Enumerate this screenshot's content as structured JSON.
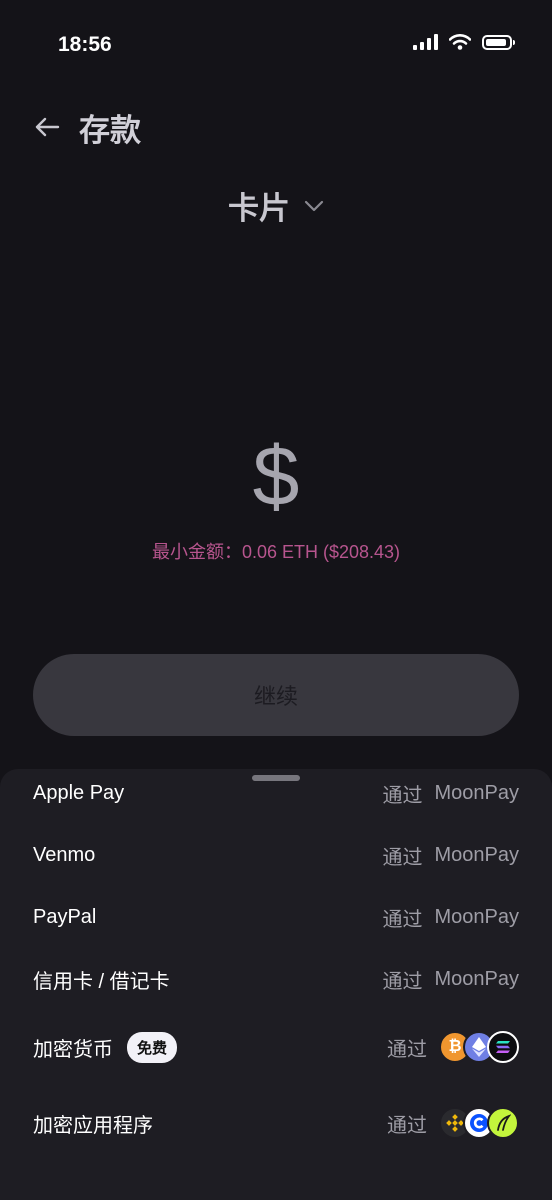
{
  "status_bar": {
    "time": "18:56"
  },
  "header": {
    "title": "存款"
  },
  "method": {
    "label": "卡片"
  },
  "amount": {
    "currency_symbol": "$",
    "min_label": "最小金额：0.06 ETH ($208.43)"
  },
  "continue_button": {
    "label": "继续"
  },
  "colors": {
    "background": "#141318",
    "sheet": "#1e1d23",
    "accent_pink": "#b7558e",
    "button_bg": "#38373e"
  },
  "payment_methods": [
    {
      "label": "Apple Pay",
      "via": "通过",
      "provider": "MoonPay"
    },
    {
      "label": "Venmo",
      "via": "通过",
      "provider": "MoonPay"
    },
    {
      "label": "PayPal",
      "via": "通过",
      "provider": "MoonPay"
    },
    {
      "label": "信用卡 / 借记卡",
      "via": "通过",
      "provider": "MoonPay"
    },
    {
      "label": "加密货币",
      "badge": "免费",
      "via": "通过",
      "icons": [
        "bitcoin-icon",
        "ethereum-icon",
        "solana-icon"
      ]
    },
    {
      "label": "加密应用程序",
      "via": "通过",
      "icons": [
        "binance-icon",
        "coinbase-icon",
        "robinhood-icon"
      ]
    }
  ]
}
